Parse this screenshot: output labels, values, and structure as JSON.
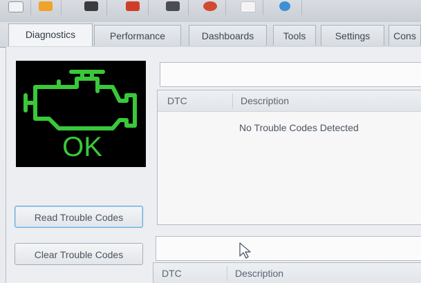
{
  "toolbar": {
    "icons": [
      "app-icon",
      "folder-icon",
      "car-icon",
      "gauge-icon",
      "speaker-icon",
      "record-icon",
      "graph-icon",
      "help-icon"
    ]
  },
  "tabs": [
    {
      "label": "Diagnostics",
      "active": true
    },
    {
      "label": "Performance",
      "active": false
    },
    {
      "label": "Dashboards",
      "active": false
    },
    {
      "label": "Tools",
      "active": false
    },
    {
      "label": "Settings",
      "active": false
    },
    {
      "label": "Cons",
      "active": false
    }
  ],
  "status": {
    "indicator_text": "OK",
    "indicator_color": "#39c83a"
  },
  "buttons": {
    "read_label": "Read Trouble Codes",
    "clear_label": "Clear Trouble Codes"
  },
  "codes_table": {
    "columns": [
      "DTC",
      "Description"
    ],
    "rows": [
      {
        "dtc": "",
        "description": "No Trouble Codes Detected"
      }
    ]
  },
  "pending_table": {
    "columns": [
      "DTC",
      "Description"
    ]
  }
}
